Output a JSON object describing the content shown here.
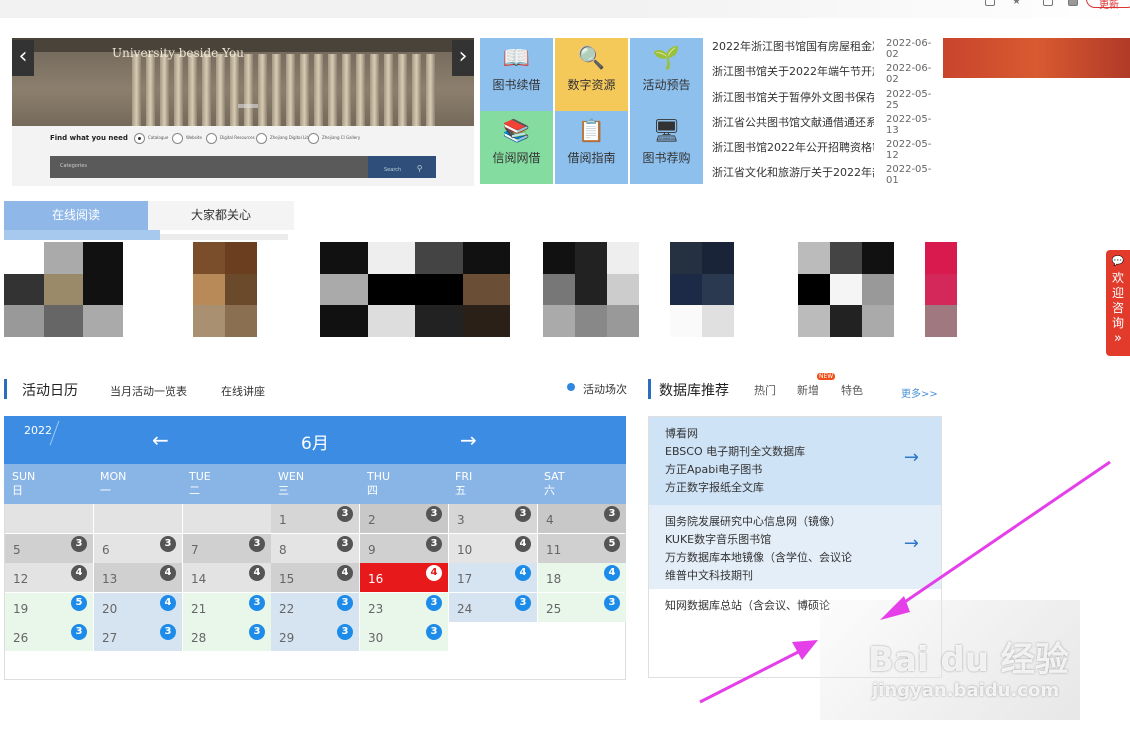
{
  "browser": {
    "update_label": "更新"
  },
  "banner": {
    "slogan": "University beside You",
    "find_label": "Find what you need",
    "options": [
      "Catalogue",
      "Website",
      "Digital Resources",
      "Zhejiang Digital Library",
      "Zhejiang CI Gallery"
    ],
    "search_placeholder": "Categories",
    "search_button": "Search",
    "slide_count": 11,
    "active_slide": 6
  },
  "tiles": [
    {
      "label": "图书续借",
      "icon": "book-icon",
      "bg": "#8ec0ee"
    },
    {
      "label": "数字资源",
      "icon": "magnifier-icon",
      "bg": "#f4c95a"
    },
    {
      "label": "活动预告",
      "icon": "sprout-icon",
      "bg": "#8ec0ee"
    },
    {
      "label": "信阅网借",
      "icon": "books-icon",
      "bg": "#84dca0"
    },
    {
      "label": "借阅指南",
      "icon": "guide-icon",
      "bg": "#8ec0ee"
    },
    {
      "label": "图书荐购",
      "icon": "monitor-icon",
      "bg": "#8ec0ee"
    }
  ],
  "news": [
    {
      "title": "2022年浙江图书馆国有房屋租金减",
      "date": "2022-06-02"
    },
    {
      "title": "浙江图书馆关于2022年端午节开放",
      "date": "2022-06-02"
    },
    {
      "title": "浙江图书馆关于暂停外文图书保存",
      "date": "2022-05-25"
    },
    {
      "title": "浙江省公共图书馆文献通借通还系",
      "date": "2022-05-13"
    },
    {
      "title": "浙江图书馆2022年公开招聘资格审",
      "date": "2022-05-12"
    },
    {
      "title": "浙江省文化和旅游厅关于2022年部",
      "date": "2022-05-01"
    }
  ],
  "reading_tabs": {
    "active": "在线阅读",
    "other": "大家都关心"
  },
  "calendar_section": {
    "title": "活动日历",
    "link1": "当月活动一览表",
    "link2": "在线讲座",
    "legend": "活动场次"
  },
  "calendar": {
    "year": "2022",
    "month": "6月",
    "prev": "←",
    "next": "→",
    "weekdays": [
      {
        "en": "SUN",
        "cn": "日"
      },
      {
        "en": "MON",
        "cn": "一"
      },
      {
        "en": "TUE",
        "cn": "二"
      },
      {
        "en": "WEN",
        "cn": "三"
      },
      {
        "en": "THU",
        "cn": "四"
      },
      {
        "en": "FRI",
        "cn": "五"
      },
      {
        "en": "SAT",
        "cn": "六"
      }
    ],
    "weeks": [
      [
        null,
        null,
        null,
        {
          "d": "1",
          "c": "3"
        },
        {
          "d": "2",
          "c": "3"
        },
        {
          "d": "3",
          "c": "3"
        },
        {
          "d": "4",
          "c": "3"
        }
      ],
      [
        {
          "d": "5",
          "c": "3"
        },
        {
          "d": "6",
          "c": "3"
        },
        {
          "d": "7",
          "c": "3"
        },
        {
          "d": "8",
          "c": "3"
        },
        {
          "d": "9",
          "c": "3"
        },
        {
          "d": "10",
          "c": "4"
        },
        {
          "d": "11",
          "c": "5"
        }
      ],
      [
        {
          "d": "12",
          "c": "4"
        },
        {
          "d": "13",
          "c": "4"
        },
        {
          "d": "14",
          "c": "4"
        },
        {
          "d": "15",
          "c": "4"
        },
        {
          "d": "16",
          "c": "4",
          "today": true
        },
        {
          "d": "17",
          "c": "4"
        },
        {
          "d": "18",
          "c": "4"
        }
      ],
      [
        {
          "d": "19",
          "c": "5"
        },
        {
          "d": "20",
          "c": "4"
        },
        {
          "d": "21",
          "c": "3"
        },
        {
          "d": "22",
          "c": "3"
        },
        {
          "d": "23",
          "c": "3"
        },
        {
          "d": "24",
          "c": "3"
        },
        {
          "d": "25",
          "c": "3"
        }
      ],
      [
        {
          "d": "26",
          "c": "3"
        },
        {
          "d": "27",
          "c": "3"
        },
        {
          "d": "28",
          "c": "3"
        },
        {
          "d": "29",
          "c": "3"
        },
        {
          "d": "30",
          "c": "3"
        },
        null,
        null
      ]
    ]
  },
  "db_section": {
    "title": "数据库推荐",
    "tabs": [
      "热门",
      "新增",
      "特色"
    ],
    "new_badge": "NEW",
    "more": "更多>>"
  },
  "databases": [
    {
      "items": [
        "博看网",
        "EBSCO 电子期刊全文数据库",
        "方正Apabi电子图书",
        "方正数字报纸全文库"
      ]
    },
    {
      "items": [
        "国务院发展研究中心信息网（镜像）",
        "KUKE数字音乐图书馆",
        "万方数据库本地镜像（含学位、会议论",
        "维普中文科技期刊"
      ]
    },
    {
      "items": [
        "知网数据库总站（含会议、博硕论"
      ]
    }
  ],
  "side_float": {
    "label": "欢迎咨询"
  },
  "watermark": {
    "brand": "Bai du 经验",
    "url": "jingyan.baidu.com"
  }
}
